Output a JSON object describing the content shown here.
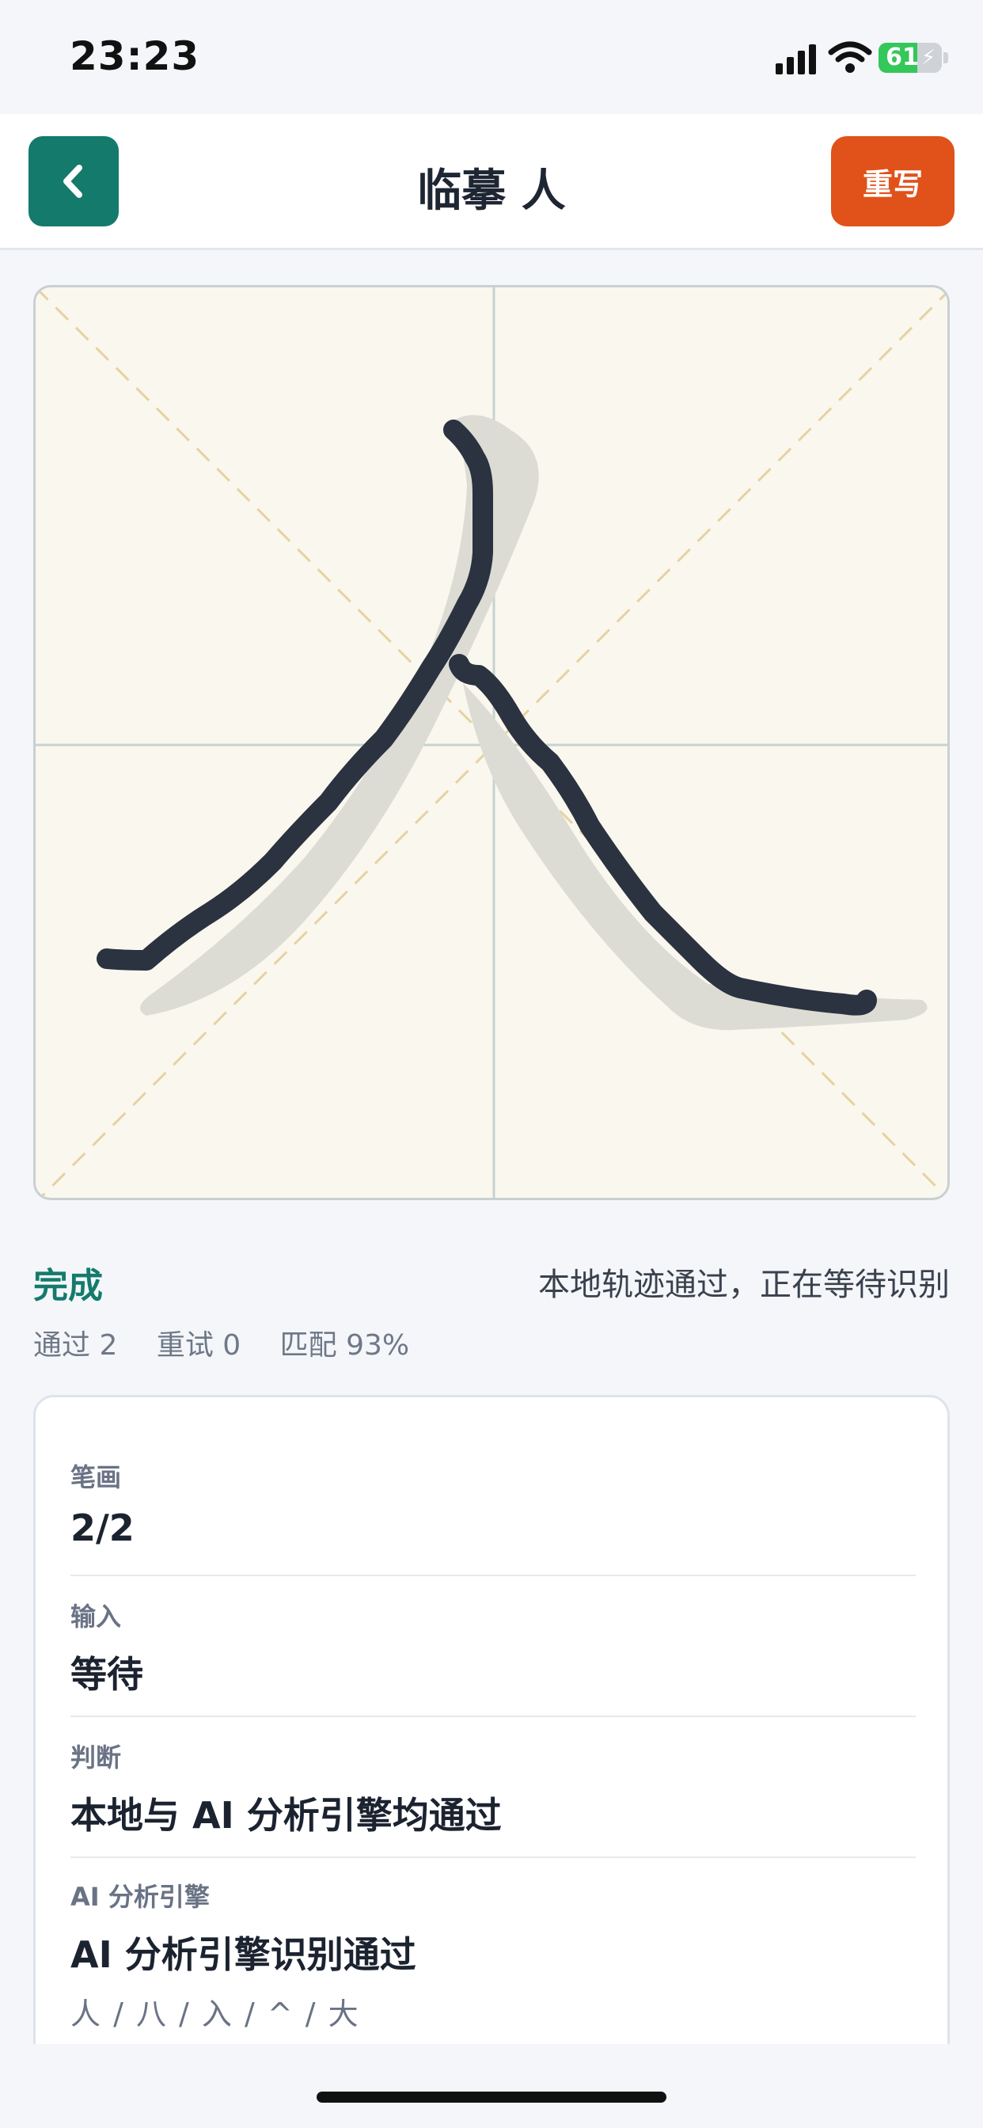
{
  "status_bar": {
    "time": "23:23",
    "battery_level": 61,
    "battery_text": "61"
  },
  "nav": {
    "title": "临摹 人",
    "rewrite_label": "重写",
    "back_icon": "chevron-left-icon"
  },
  "canvas": {
    "character": "人",
    "background_color": "#faf7ee",
    "stroke_color": "#2b3240"
  },
  "result": {
    "status": "完成",
    "message": "本地轨迹通过，正在等待识别",
    "stats": {
      "pass": "通过 2",
      "retry": "重试 0",
      "match": "匹配 93%"
    }
  },
  "details": {
    "strokes_label": "笔画",
    "strokes_value": "2/2",
    "input_label": "输入",
    "input_value": "等待",
    "judgement_label": "判断",
    "judgement_value": "本地与 AI 分析引擎均通过",
    "engine_label": "AI 分析引擎",
    "engine_value": "AI 分析引擎识别通过",
    "engine_candidates": "人 / 八 / 入 / ^ / 大"
  },
  "colors": {
    "accent": "#147a6c",
    "danger": "#e0521a"
  }
}
